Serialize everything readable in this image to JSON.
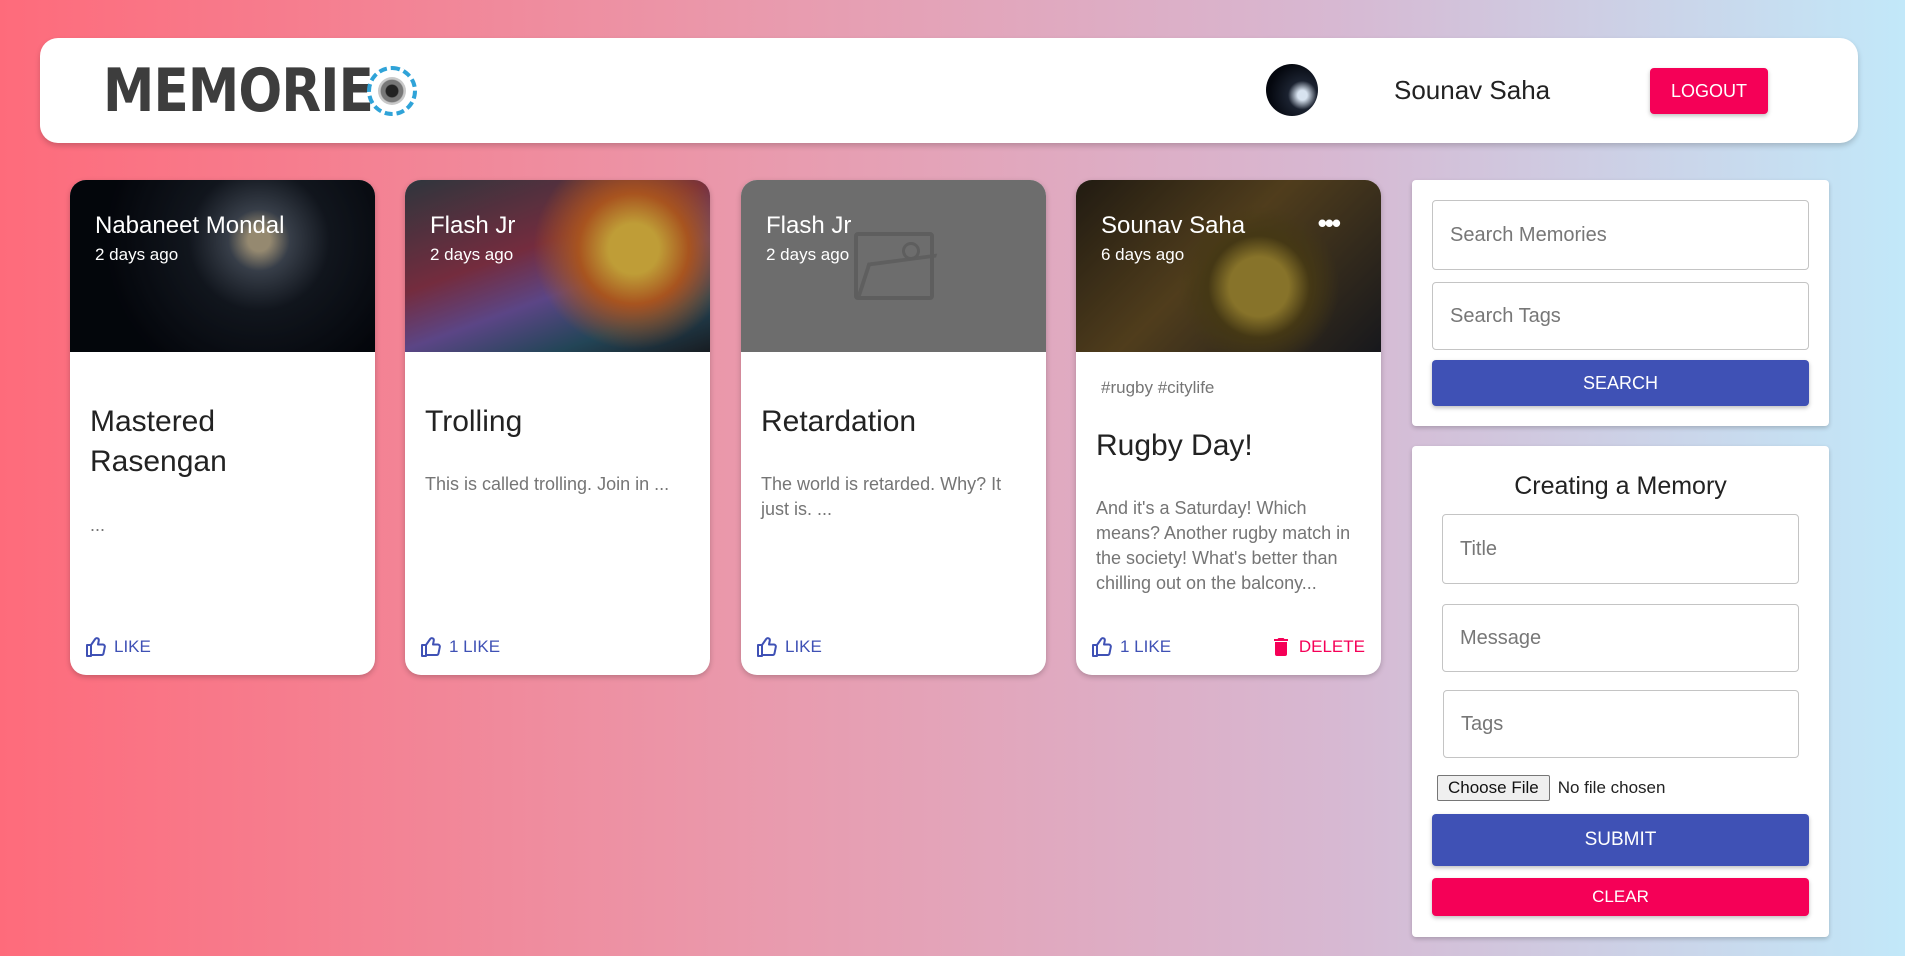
{
  "header": {
    "brand": "MEMORIES",
    "username": "Sounav Saha",
    "logout_label": "LOGOUT"
  },
  "posts": [
    {
      "author": "Nabaneet Mondal",
      "time": "2 days ago",
      "tags": "",
      "title": "Mastered Rasengan",
      "message": "...",
      "like_label": "LIKE"
    },
    {
      "author": "Flash Jr",
      "time": "2 days ago",
      "tags": "",
      "title": "Trolling",
      "message": "This is called trolling. Join in ...",
      "like_label": "1 LIKE"
    },
    {
      "author": "Flash Jr",
      "time": "2 days ago",
      "tags": "",
      "title": "Retardation",
      "message": "The world is retarded. Why? It just is. ...",
      "like_label": "LIKE"
    },
    {
      "author": "Sounav Saha",
      "time": "6 days ago",
      "tags": "#rugby #citylife",
      "title": "Rugby Day!",
      "message": "And it's a Saturday! Which means? Another rugby match in the society! What's better than chilling out on the balcony...",
      "like_label": "1 LIKE",
      "delete_label": "DELETE"
    }
  ],
  "search": {
    "memories_placeholder": "Search Memories",
    "tags_placeholder": "Search Tags",
    "button_label": "SEARCH"
  },
  "form": {
    "title": "Creating a Memory",
    "title_placeholder": "Title",
    "message_placeholder": "Message",
    "tags_placeholder": "Tags",
    "choose_file_label": "Choose File",
    "no_file_text": "No file chosen",
    "submit_label": "SUBMIT",
    "clear_label": "CLEAR"
  },
  "colors": {
    "primary": "#3f51b5",
    "secondary": "#f50057",
    "gradient_start": "#fe6b7b",
    "gradient_end": "#c2e8f9"
  }
}
